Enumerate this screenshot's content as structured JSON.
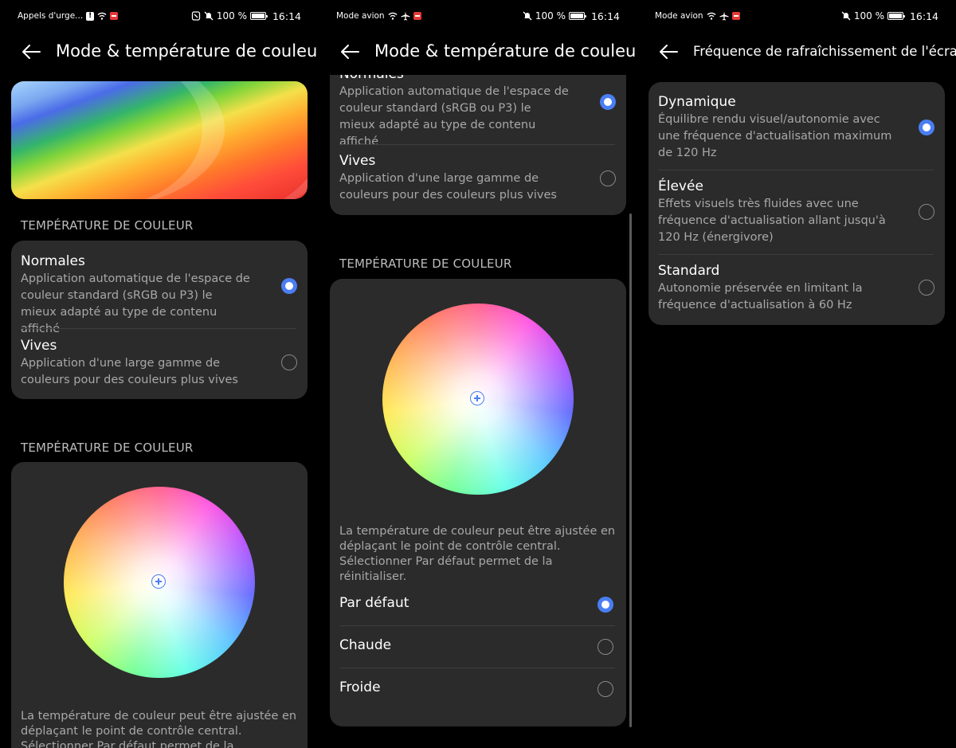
{
  "screen1": {
    "status": {
      "left_text": "Appels d'urge...",
      "battery": "100 %",
      "time": "16:14"
    },
    "title": "Mode & température de couleur",
    "section1": "TEMPÉRATURE DE COULEUR",
    "options": [
      {
        "title": "Normales",
        "desc": "Application automatique de l'espace de couleur standard (sRGB ou P3) le mieux adapté au type de contenu affiché",
        "selected": true
      },
      {
        "title": "Vives",
        "desc": "Application d'une large gamme de couleurs pour des couleurs plus vives",
        "selected": false
      }
    ],
    "section2": "TEMPÉRATURE DE COULEUR",
    "paragraph": "La température de couleur peut être ajustée en déplaçant le point de contrôle central. Sélectionner Par défaut permet de la réinitialiser."
  },
  "screen2": {
    "status": {
      "left_text": "Mode avion",
      "battery": "100 %",
      "time": "16:14"
    },
    "title": "Mode & température de couleur",
    "options": [
      {
        "title": "Normales",
        "desc": "Application automatique de l'espace de couleur standard (sRGB ou P3) le mieux adapté au type de contenu affiché",
        "selected": true
      },
      {
        "title": "Vives",
        "desc": "Application d'une large gamme de couleurs pour des couleurs plus vives",
        "selected": false
      }
    ],
    "section": "TEMPÉRATURE DE COULEUR",
    "paragraph": "La température de couleur peut être ajustée en déplaçant le point de contrôle central. Sélectionner Par défaut permet de la réinitialiser.",
    "temps": [
      {
        "label": "Par défaut",
        "selected": true
      },
      {
        "label": "Chaude",
        "selected": false
      },
      {
        "label": "Froide",
        "selected": false
      }
    ]
  },
  "screen3": {
    "status": {
      "left_text": "Mode avion",
      "battery": "100 %",
      "time": "16:14"
    },
    "title": "Fréquence de rafraîchissement de l'écran",
    "options": [
      {
        "title": "Dynamique",
        "desc": "Équilibre rendu visuel/autonomie avec une fréquence d'actualisation maximum de 120 Hz",
        "selected": true
      },
      {
        "title": "Élevée",
        "desc": "Effets visuels très fluides avec une fréquence d'actualisation allant jusqu'à 120 Hz (énergivore)",
        "selected": false
      },
      {
        "title": "Standard",
        "desc": "Autonomie préservée en limitant la fréquence d'actualisation à 60 Hz",
        "selected": false
      }
    ]
  },
  "colors": {
    "accent": "#4a7ef3",
    "card": "#2b2b2b",
    "background": "#000000"
  }
}
